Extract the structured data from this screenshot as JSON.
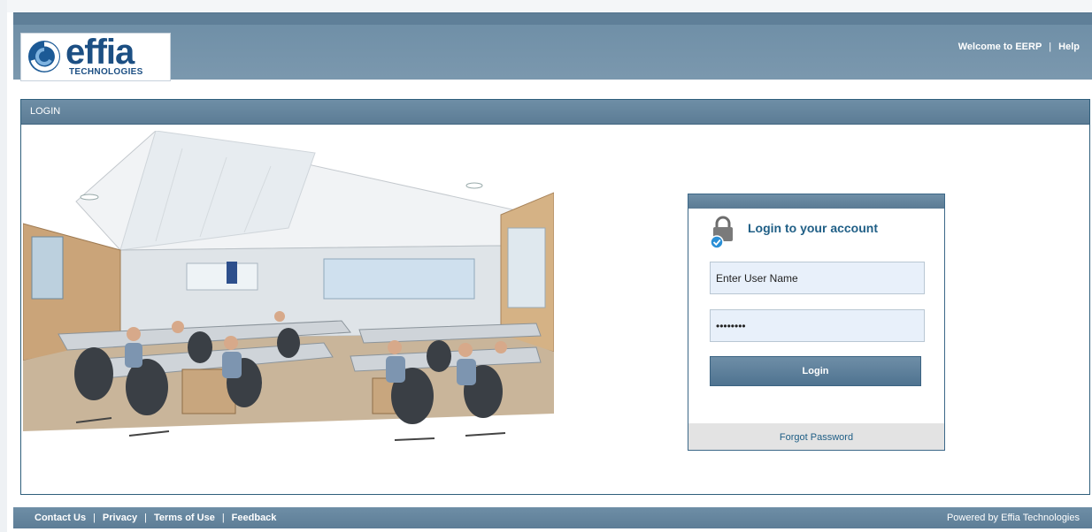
{
  "header": {
    "logo_word": "effia",
    "logo_sub": "TECHNOLOGIES",
    "welcome_label": "Welcome to EERP",
    "separator": "|",
    "help_label": "Help"
  },
  "panel": {
    "title": "LOGIN"
  },
  "login": {
    "title": "Login to your account",
    "username_value": "Enter User Name",
    "password_value": "••••••••",
    "button_label": "Login",
    "forgot_label": "Forgot Password"
  },
  "footer": {
    "links": [
      "Contact Us",
      "Privacy",
      "Terms of Use",
      "Feedback"
    ],
    "separator": "|",
    "powered_label": "Powered by Effia Technologies"
  },
  "colors": {
    "header_bar": "#6f8fa7",
    "brand_blue": "#1c4f83",
    "link_blue": "#205f86",
    "input_bg": "#e8f0fa"
  },
  "icons": {
    "logo": "effia-swirl-logo",
    "lock": "lock-check-icon"
  }
}
